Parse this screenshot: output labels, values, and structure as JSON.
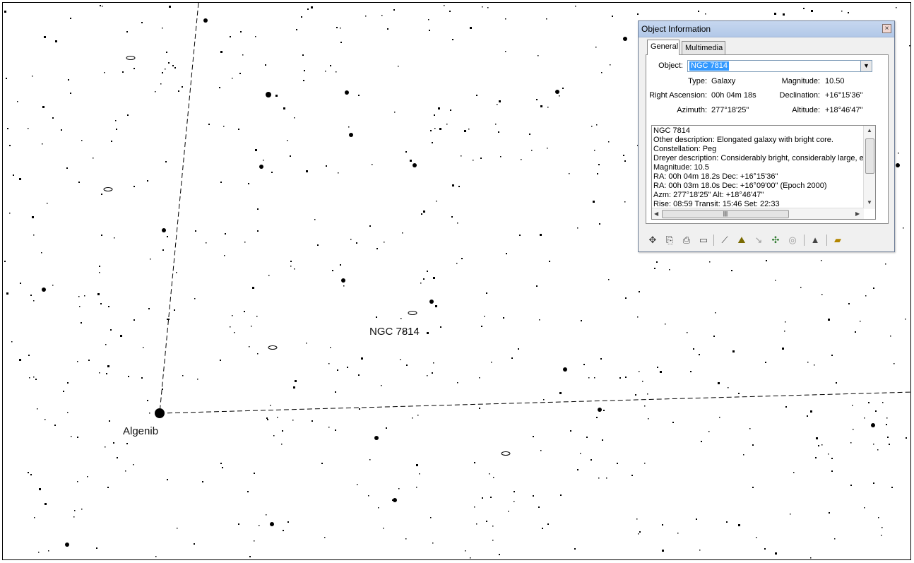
{
  "chart": {
    "labels": {
      "star_name": "Algenib",
      "object_name": "NGC 7814"
    }
  },
  "dialog": {
    "title": "Object Information",
    "close_symbol": "×",
    "tabs": [
      "General",
      "Multimedia"
    ],
    "object_label": "Object:",
    "object_value": "NGC 7814",
    "fields": {
      "type_label": "Type:",
      "type_value": "Galaxy",
      "magnitude_label": "Magnitude:",
      "magnitude_value": "10.50",
      "ra_label": "Right Ascension:",
      "ra_value": "00h 04m 18s",
      "dec_label": "Declination:",
      "dec_value": "+16°15'36\"",
      "azimuth_label": "Azimuth:",
      "azimuth_value": "277°18'25\"",
      "altitude_label": "Altitude:",
      "altitude_value": "+18°46'47\""
    },
    "description_lines": [
      "NGC 7814",
      "Other description: Elongated galaxy with bright core.",
      "Constellation:  Peg",
      "Dreyer description: Considerably bright, considerably large, extended",
      "Magnitude: 10.5",
      "RA: 00h 04m 18.2s  Dec: +16°15'36\"",
      "RA: 00h 03m 18.0s  Dec: +16°09'00\"  (Epoch 2000)",
      "Azm: 277°18'25\"  Alt: +18°46'47\"",
      "Rise: 08:59  Transit: 15:46  Set: 22:33"
    ],
    "toolbar_icons": [
      "center-icon",
      "copy-icon",
      "print-icon",
      "book-icon",
      "telescope-icon",
      "landscape-icon",
      "orbit-icon",
      "finder-chart-icon",
      "ring-icon",
      "up-arrow-icon",
      "open-folder-icon"
    ]
  }
}
